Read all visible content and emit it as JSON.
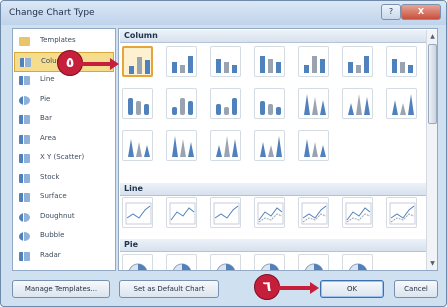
{
  "window": {
    "title": "Change Chart Type",
    "help_label": "?",
    "close_label": "X"
  },
  "colors": {
    "accent": "#c61f3b",
    "selection": "#f6dd8e",
    "chart_blue": "#4f81bd",
    "chart_grey": "#9aa4b0"
  },
  "categories": [
    {
      "label": "Templates",
      "icon": "templates-folder-icon"
    },
    {
      "label": "Column",
      "icon": "column-chart-icon",
      "selected": true
    },
    {
      "label": "Line",
      "icon": "line-chart-icon"
    },
    {
      "label": "Pie",
      "icon": "pie-chart-icon"
    },
    {
      "label": "Bar",
      "icon": "bar-chart-icon"
    },
    {
      "label": "Area",
      "icon": "area-chart-icon"
    },
    {
      "label": "X Y (Scatter)",
      "icon": "scatter-chart-icon"
    },
    {
      "label": "Stock",
      "icon": "stock-chart-icon"
    },
    {
      "label": "Surface",
      "icon": "surface-chart-icon"
    },
    {
      "label": "Doughnut",
      "icon": "doughnut-chart-icon"
    },
    {
      "label": "Bubble",
      "icon": "bubble-chart-icon"
    },
    {
      "label": "Radar",
      "icon": "radar-chart-icon"
    }
  ],
  "sections": {
    "column": "Column",
    "line": "Line",
    "pie": "Pie"
  },
  "column_thumbs": [
    "clustered-column",
    "stacked-column",
    "100-stacked-column",
    "3d-clustered-column",
    "3d-stacked-column",
    "3d-100-stacked-column",
    "3d-column",
    "clustered-cylinder",
    "stacked-cylinder",
    "100-stacked-cylinder",
    "3d-cylinder",
    "clustered-cone",
    "stacked-cone",
    "100-stacked-cone",
    "3d-cone",
    "clustered-pyramid",
    "stacked-pyramid",
    "100-stacked-pyramid",
    "3d-pyramid"
  ],
  "line_thumbs": [
    "line",
    "stacked-line",
    "100-stacked-line",
    "line-with-markers",
    "stacked-line-with-markers",
    "100-stacked-line-with-markers",
    "3d-line"
  ],
  "pie_thumbs": [
    "pie",
    "3d-pie",
    "pie-of-pie",
    "exploded-pie",
    "3d-exploded-pie",
    "bar-of-pie"
  ],
  "buttons": {
    "manage_templates": "Manage Templates...",
    "set_default": "Set as Default Chart",
    "ok": "OK",
    "cancel": "Cancel"
  },
  "callouts": {
    "step5": "٥",
    "step6": "٦"
  }
}
